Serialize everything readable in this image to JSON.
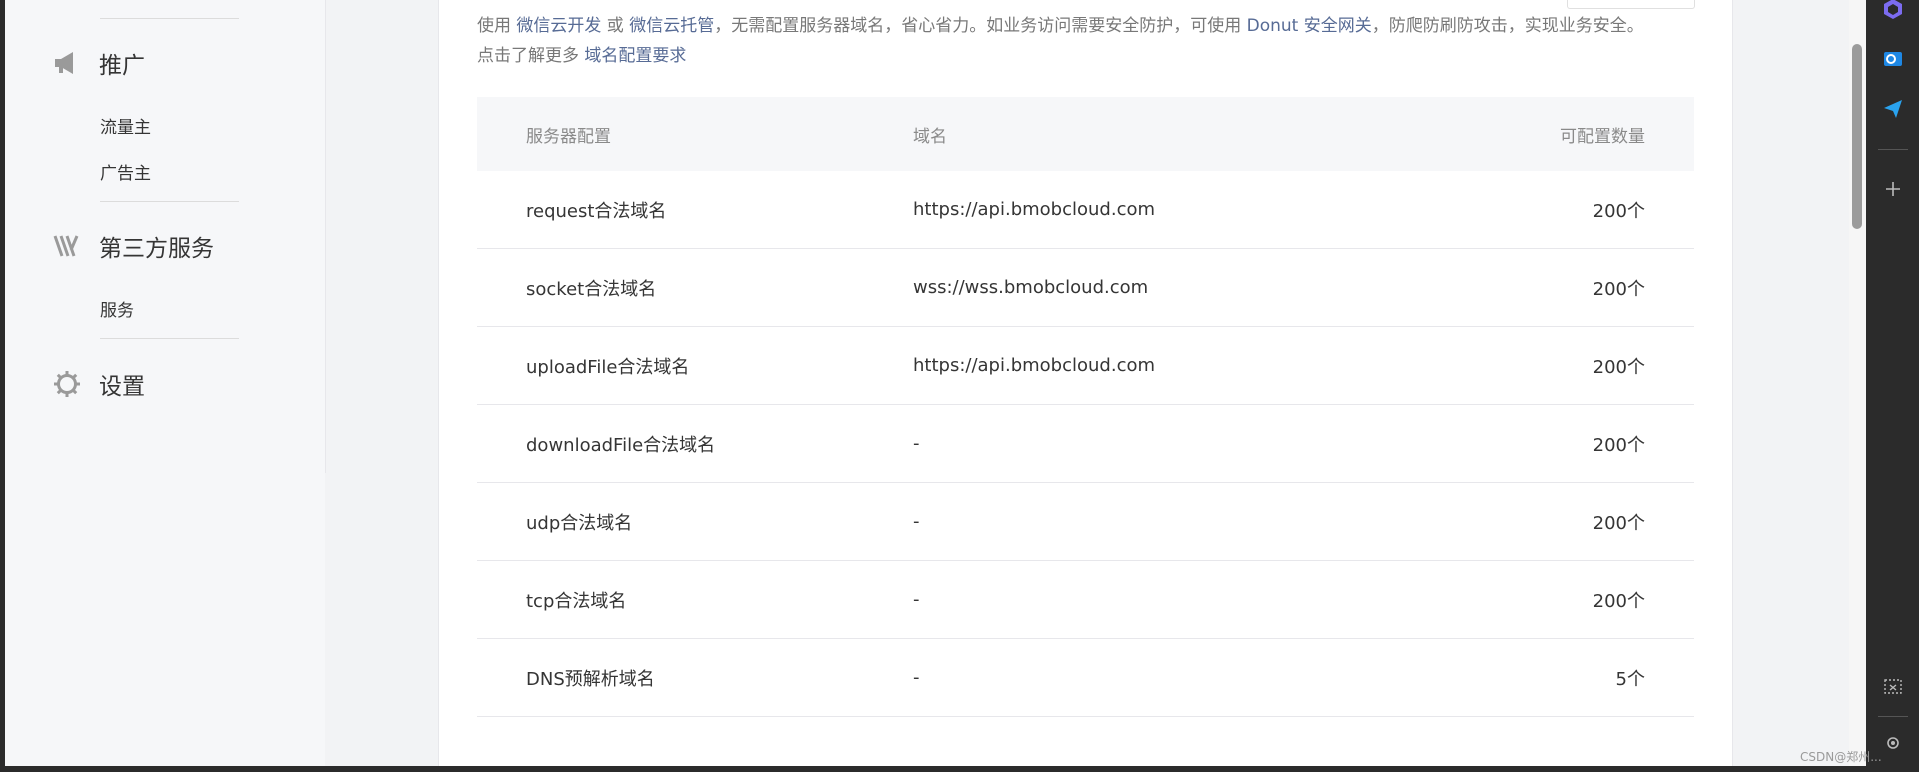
{
  "sidebar": {
    "sections": [
      {
        "title": "推广",
        "icon": "megaphone-icon",
        "items": [
          "流量主",
          "广告主"
        ]
      },
      {
        "title": "第三方服务",
        "icon": "third-party-icon",
        "items": [
          "服务"
        ]
      },
      {
        "title": "设置",
        "icon": "gear-icon",
        "items": []
      }
    ]
  },
  "description": {
    "p1": "使用 ",
    "link_dev": "微信云开发",
    "p2": " 或 ",
    "link_host": "微信云托管",
    "p3": "，无需配置服务器域名，省心省力。如业务访问需要安全防护，可使用 ",
    "link_gateway": "Donut 安全网关",
    "p4": "，防爬防刷防攻击，实现业务安全。",
    "p5": "点击了解更多 ",
    "link_req": "域名配置要求"
  },
  "table": {
    "headers": [
      "服务器配置",
      "域名",
      "可配置数量"
    ],
    "rows": [
      [
        "request合法域名",
        "https://api.bmobcloud.com",
        "200个"
      ],
      [
        "socket合法域名",
        "wss://wss.bmobcloud.com",
        "200个"
      ],
      [
        "uploadFile合法域名",
        "https://api.bmobcloud.com",
        "200个"
      ],
      [
        "downloadFile合法域名",
        "-",
        "200个"
      ],
      [
        "udp合法域名",
        "-",
        "200个"
      ],
      [
        "tcp合法域名",
        "-",
        "200个"
      ],
      [
        "DNS预解析域名",
        "-",
        "5个"
      ]
    ]
  },
  "watermark": "CSDN@郑州...",
  "colors": {
    "link": "#576b95",
    "text": "#353535",
    "muted": "#787878",
    "header_bg": "#f6f7f9",
    "rightbar": "#2b2b2b"
  }
}
